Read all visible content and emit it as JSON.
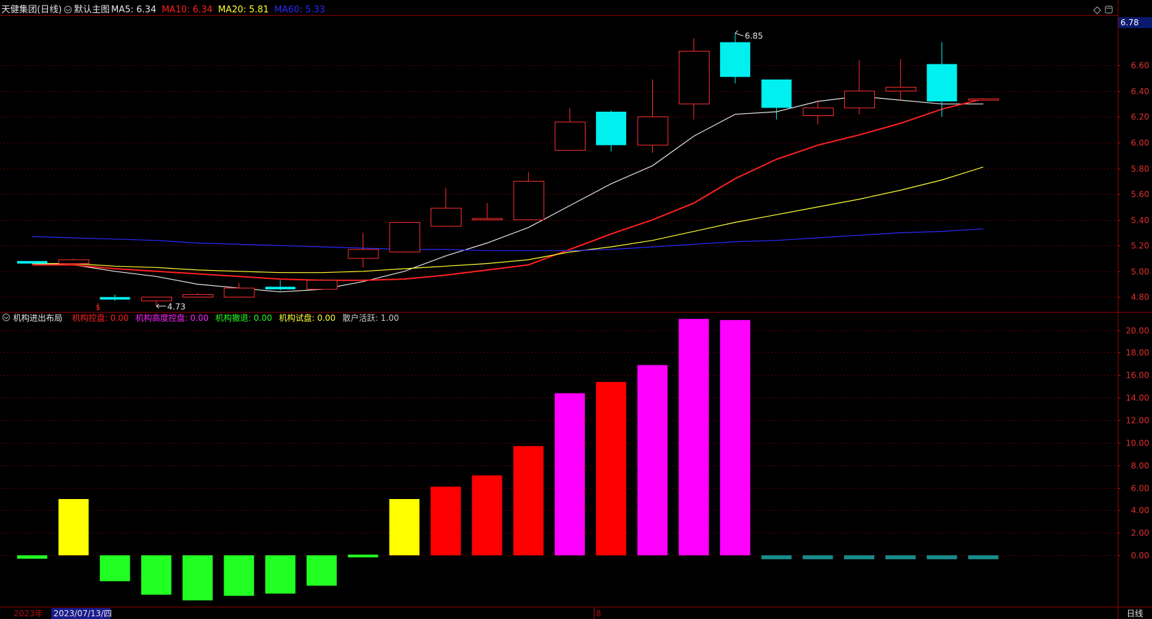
{
  "top_header": {
    "title": "天健集团(日线)",
    "main_chart_label": "默认主图",
    "ma_items": [
      {
        "label": "MA5:",
        "value": "6.34",
        "color": "#e6e6e6"
      },
      {
        "label": "MA10:",
        "value": "6.34",
        "color": "#ff2020"
      },
      {
        "label": "MA20:",
        "value": "5.81",
        "color": "#ffff33"
      },
      {
        "label": "MA60:",
        "value": "5.33",
        "color": "#2a2aff"
      }
    ]
  },
  "bottom_header": {
    "title": "机构进出布局",
    "items": [
      {
        "label": "机构控盘:",
        "value": "0.00",
        "color": "#ff2020"
      },
      {
        "label": "机构高度控盘:",
        "value": "0.00",
        "color": "#ff22ff"
      },
      {
        "label": "机构撤退:",
        "value": "0.00",
        "color": "#22ff22"
      },
      {
        "label": "机构试盘:",
        "value": "0.00",
        "color": "#ffff33"
      },
      {
        "label": "散户活跃:",
        "value": "1.00",
        "color": "#cccccc"
      }
    ]
  },
  "footer": {
    "year": "2023年",
    "date": "2023/07/13/四",
    "month_marker": "8",
    "period": "日线"
  },
  "current_price_tag": "6.78",
  "chart_data": [
    {
      "type": "candlestick",
      "ylim": [
        4.69,
        6.98
      ],
      "y_ticks": [
        "6.60",
        "6.40",
        "6.20",
        "6.00",
        "5.80",
        "5.60",
        "5.40",
        "5.20",
        "5.00",
        "4.80"
      ],
      "annotations": [
        {
          "text": "6.85",
          "at": "high"
        },
        {
          "text": "4.73",
          "at": "low"
        }
      ],
      "candles": [
        {
          "o": 5.06,
          "c": 5.08,
          "h": 5.08,
          "l": 5.06,
          "up": false
        },
        {
          "o": 5.06,
          "c": 5.09,
          "h": 5.1,
          "l": 5.06,
          "up": true
        },
        {
          "o": 4.8,
          "c": 4.78,
          "h": 4.82,
          "l": 4.77,
          "up": false
        },
        {
          "o": 4.77,
          "c": 4.8,
          "h": 4.8,
          "l": 4.73,
          "up": true
        },
        {
          "o": 4.8,
          "c": 4.82,
          "h": 4.83,
          "l": 4.8,
          "up": true
        },
        {
          "o": 4.8,
          "c": 4.87,
          "h": 4.91,
          "l": 4.8,
          "up": true
        },
        {
          "o": 4.88,
          "c": 4.86,
          "h": 4.93,
          "l": 4.85,
          "up": false
        },
        {
          "o": 4.86,
          "c": 4.93,
          "h": 4.94,
          "l": 4.86,
          "up": true
        },
        {
          "o": 5.1,
          "c": 5.17,
          "h": 5.3,
          "l": 5.03,
          "up": true
        },
        {
          "o": 5.15,
          "c": 5.38,
          "h": 5.38,
          "l": 5.15,
          "up": true
        },
        {
          "o": 5.35,
          "c": 5.49,
          "h": 5.65,
          "l": 5.35,
          "up": true
        },
        {
          "o": 5.4,
          "c": 5.41,
          "h": 5.53,
          "l": 5.4,
          "up": true
        },
        {
          "o": 5.4,
          "c": 5.7,
          "h": 5.77,
          "l": 5.4,
          "up": true
        },
        {
          "o": 5.94,
          "c": 6.16,
          "h": 6.27,
          "l": 5.94,
          "up": true
        },
        {
          "o": 6.24,
          "c": 5.98,
          "h": 6.25,
          "l": 5.93,
          "up": false
        },
        {
          "o": 5.98,
          "c": 6.2,
          "h": 6.49,
          "l": 5.92,
          "up": true
        },
        {
          "o": 6.3,
          "c": 6.71,
          "h": 6.81,
          "l": 6.18,
          "up": true
        },
        {
          "o": 6.78,
          "c": 6.51,
          "h": 6.85,
          "l": 6.46,
          "up": false
        },
        {
          "o": 6.49,
          "c": 6.27,
          "h": 6.49,
          "l": 6.18,
          "up": false
        },
        {
          "o": 6.21,
          "c": 6.27,
          "h": 6.33,
          "l": 6.14,
          "up": true
        },
        {
          "o": 6.27,
          "c": 6.4,
          "h": 6.64,
          "l": 6.22,
          "up": true
        },
        {
          "o": 6.4,
          "c": 6.43,
          "h": 6.65,
          "l": 6.33,
          "up": true
        },
        {
          "o": 6.61,
          "c": 6.32,
          "h": 6.78,
          "l": 6.2,
          "up": false
        },
        {
          "o": 6.34,
          "c": 6.34,
          "h": 6.34,
          "l": 6.34,
          "up": true
        }
      ],
      "series": [
        {
          "name": "MA5",
          "color": "#e6e6e6",
          "values": [
            5.06,
            5.05,
            5.0,
            4.96,
            4.9,
            4.87,
            4.84,
            4.86,
            4.92,
            5.0,
            5.12,
            5.22,
            5.34,
            5.51,
            5.68,
            5.82,
            6.05,
            6.22,
            6.24,
            6.32,
            6.36,
            6.33,
            6.3,
            6.3
          ]
        },
        {
          "name": "MA10",
          "color": "#ff2020",
          "values": [
            5.05,
            5.05,
            5.02,
            5.0,
            4.98,
            4.96,
            4.94,
            4.93,
            4.93,
            4.94,
            4.97,
            5.01,
            5.05,
            5.17,
            5.29,
            5.4,
            5.53,
            5.72,
            5.87,
            5.98,
            6.06,
            6.15,
            6.26,
            6.34
          ]
        },
        {
          "name": "MA20",
          "color": "#ffff33",
          "values": [
            5.06,
            5.06,
            5.04,
            5.03,
            5.01,
            5.0,
            4.99,
            4.99,
            5.0,
            5.02,
            5.04,
            5.06,
            5.09,
            5.15,
            5.19,
            5.24,
            5.31,
            5.38,
            5.44,
            5.5,
            5.56,
            5.63,
            5.71,
            5.81
          ]
        },
        {
          "name": "MA60",
          "color": "#2a2aff",
          "values": [
            5.27,
            5.26,
            5.25,
            5.24,
            5.22,
            5.21,
            5.2,
            5.19,
            5.18,
            5.17,
            5.17,
            5.16,
            5.16,
            5.16,
            5.17,
            5.19,
            5.21,
            5.23,
            5.24,
            5.26,
            5.28,
            5.3,
            5.31,
            5.33
          ]
        }
      ]
    },
    {
      "type": "bar",
      "ylim": [
        -4.5,
        21.5
      ],
      "y_ticks": [
        "20.00",
        "18.00",
        "16.00",
        "14.00",
        "12.00",
        "10.00",
        "8.00",
        "6.00",
        "4.00",
        "2.00",
        "0.00"
      ],
      "bars": [
        {
          "value": -0.3,
          "color": "#22ff22"
        },
        {
          "value": 5.0,
          "color": "#ffff00"
        },
        {
          "value": -2.3,
          "color": "#22ff22"
        },
        {
          "value": -3.5,
          "color": "#22ff22"
        },
        {
          "value": -4.0,
          "color": "#22ff22"
        },
        {
          "value": -3.6,
          "color": "#22ff22"
        },
        {
          "value": -3.4,
          "color": "#22ff22"
        },
        {
          "value": -2.7,
          "color": "#22ff22"
        },
        {
          "value": -0.1,
          "color": "#22ff22"
        },
        {
          "value": 5.0,
          "color": "#ffff00"
        },
        {
          "value": 6.1,
          "color": "#ff0000"
        },
        {
          "value": 7.1,
          "color": "#ff0000"
        },
        {
          "value": 9.7,
          "color": "#ff0000"
        },
        {
          "value": 14.4,
          "color": "#ff00ff"
        },
        {
          "value": 15.4,
          "color": "#ff0000"
        },
        {
          "value": 16.9,
          "color": "#ff00ff"
        },
        {
          "value": 21.0,
          "color": "#ff00ff"
        },
        {
          "value": 20.9,
          "color": "#ff00ff"
        },
        {
          "value": -0.35,
          "color": "#1a8c8c"
        },
        {
          "value": -0.35,
          "color": "#1a8c8c"
        },
        {
          "value": -0.35,
          "color": "#1a8c8c"
        },
        {
          "value": -0.35,
          "color": "#1a8c8c"
        },
        {
          "value": -0.35,
          "color": "#1a8c8c"
        },
        {
          "value": -0.35,
          "color": "#1a8c8c"
        }
      ]
    }
  ]
}
